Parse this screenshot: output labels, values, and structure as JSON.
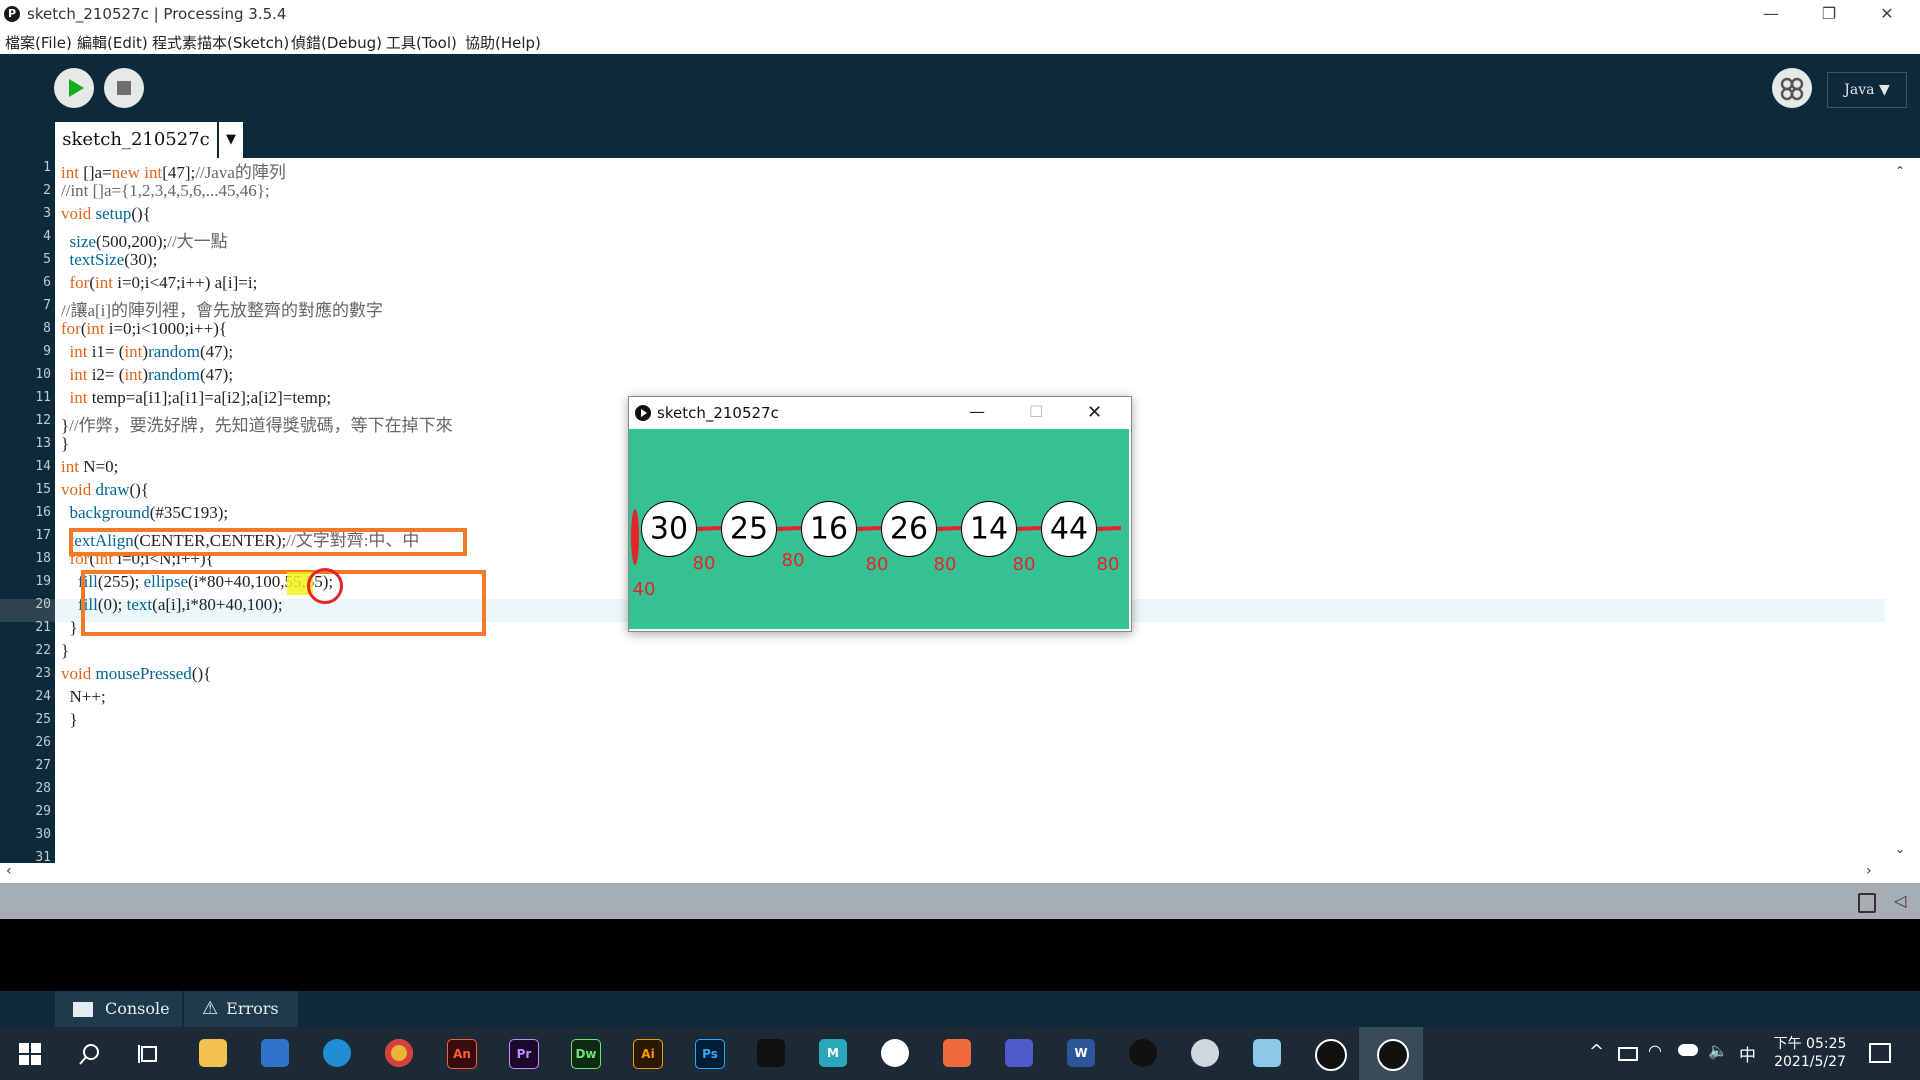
{
  "window": {
    "title": "sketch_210527c | Processing 3.5.4",
    "controls": [
      "—",
      "❐",
      "✕"
    ]
  },
  "menu": [
    "檔案(File)",
    "編輯(Edit)",
    "程式素描本(Sketch)",
    "偵錯(Debug)",
    "工具(Tool)",
    "協助(Help)"
  ],
  "toolbar": {
    "mode": "Java ▼",
    "tab_name": "sketch_210527c",
    "tab_arrow": "▼"
  },
  "editor": {
    "line_numbers": [
      "1",
      "2",
      "3",
      "4",
      "5",
      "6",
      "7",
      "8",
      "9",
      "10",
      "11",
      "12",
      "13",
      "14",
      "15",
      "16",
      "17",
      "18",
      "19",
      "20",
      "21",
      "22",
      "23",
      "24",
      "25",
      "26",
      "27",
      "28",
      "29",
      "30",
      "31"
    ],
    "highlight_line": "20",
    "lines": [
      "int []a=new int[47];//Java的陣列",
      "//int []a={1,2,3,4,5,6,...45,46};",
      "void setup(){",
      "  size(500,200);//大一點",
      "  textSize(30);",
      "  for(int i=0;i<47;i++) a[i]=i;",
      "//讓a[i]的陣列裡，會先放整齊的對應的數字",
      "for(int i=0;i<1000;i++){",
      "  int i1= (int)random(47);",
      "  int i2= (int)random(47);",
      "  int temp=a[i1];a[i1]=a[i2];a[i2]=temp;",
      "}//作弊，要洗好牌，先知道得獎號碼，等下在掉下來",
      "}",
      "int N=0;",
      "void draw(){",
      "  background(#35C193);",
      "  textAlign(CENTER,CENTER);//文字對齊:中、中",
      "  for(int i=0;i<N;i++){",
      "    fill(255); ellipse(i*80+40,100,55,55);",
      "    fill(0); text(a[i],i*80+40,100);",
      "  }",
      "}",
      "void mousePressed(){",
      "  N++;",
      "  }"
    ]
  },
  "console_tabs": {
    "console": "Console",
    "errors": "Errors"
  },
  "sketch_window": {
    "title": "sketch_210527c",
    "controls": [
      "—",
      "☐",
      "✕"
    ],
    "numbers": [
      "30",
      "25",
      "16",
      "26",
      "14",
      "44"
    ],
    "annotations": [
      "80",
      "80",
      "80",
      "80",
      "80",
      "80",
      "40"
    ],
    "background_color": "#35C193"
  },
  "taskbar": {
    "apps": [
      "An",
      "Pr",
      "Dw",
      "Ai",
      "Ps",
      "M",
      "W"
    ],
    "tray_lang": "中",
    "time": "下午 05:25",
    "date": "2021/5/27"
  },
  "colors": {
    "accent_orange": "#F47A28",
    "annotation_red": "#E8222A",
    "editor_dark": "#0D2A3A"
  }
}
